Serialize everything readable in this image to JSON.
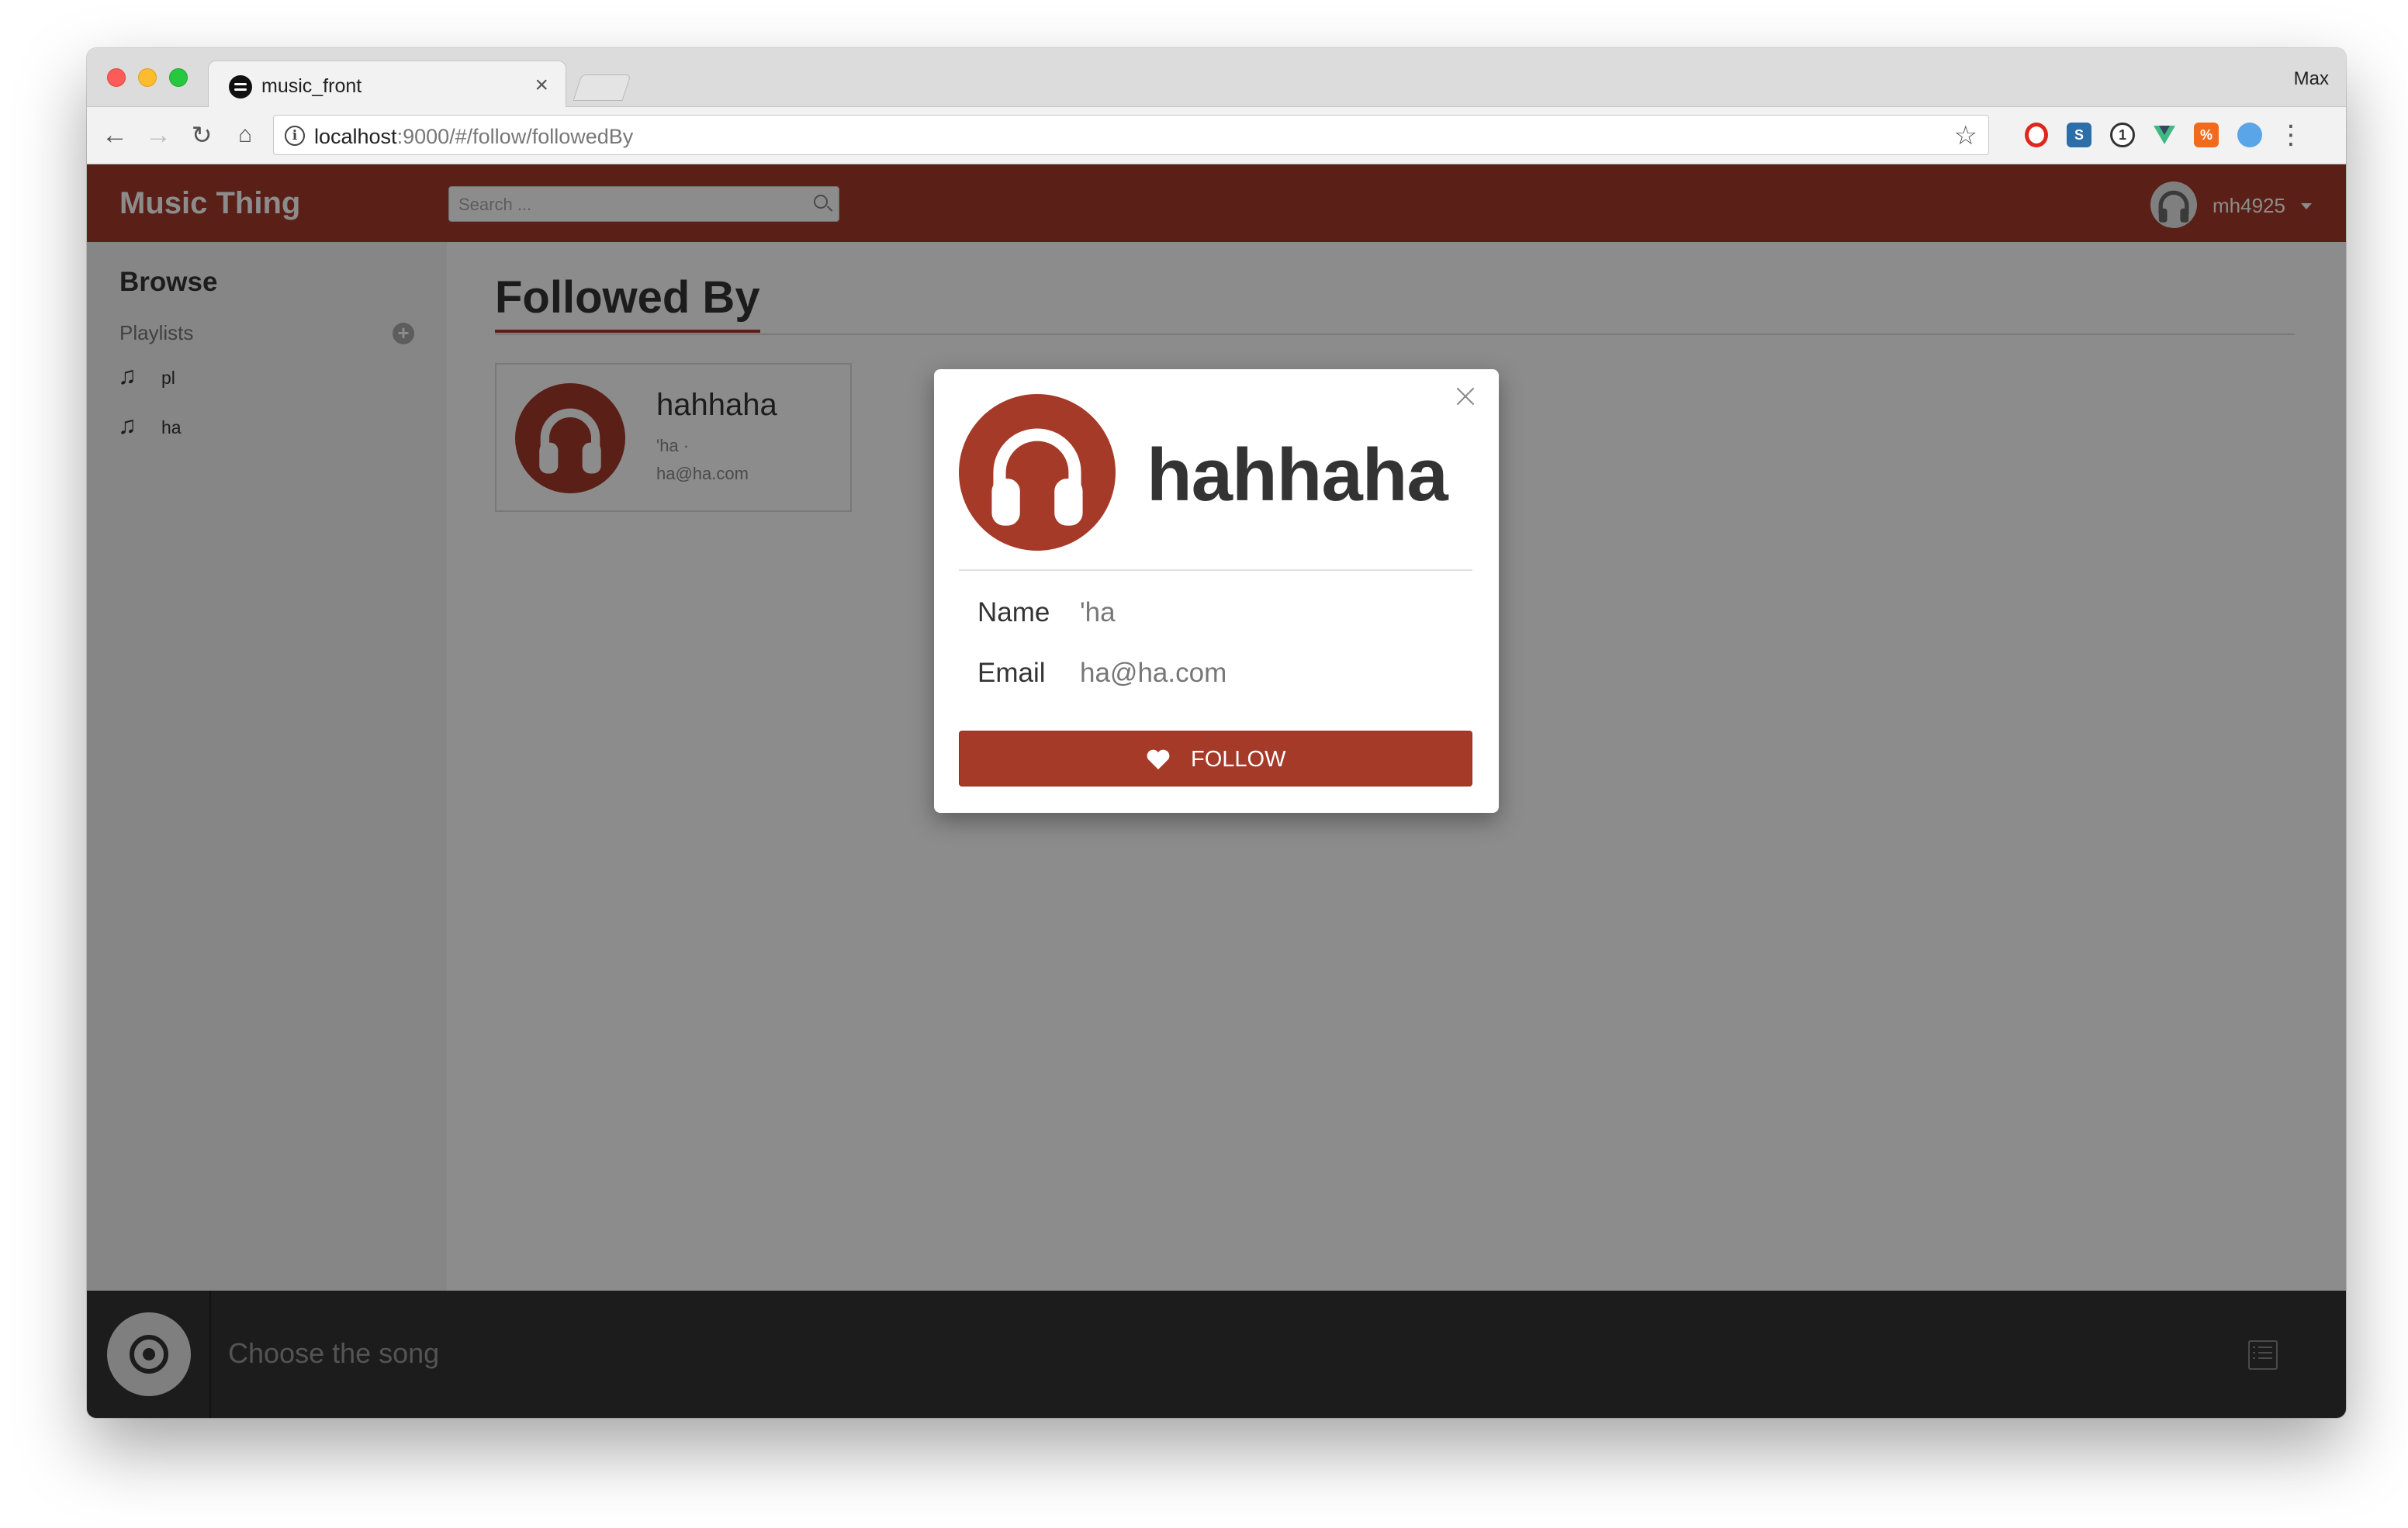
{
  "browser": {
    "tab_title": "music_front",
    "tab_close": "×",
    "profile_name": "Max",
    "url_host": "localhost",
    "url_rest": ":9000/#/follow/followedBy",
    "back": "←",
    "forward": "→",
    "reload": "↻",
    "home": "⌂",
    "info": "i",
    "star": "☆",
    "menu": "⋮",
    "extensions": {
      "s": "S",
      "onepass": "1",
      "pct": "%"
    }
  },
  "app": {
    "brand": "Music Thing",
    "search": {
      "placeholder": "Search ..."
    },
    "user": {
      "name": "mh4925"
    }
  },
  "sidebar": {
    "title": "Browse",
    "section": "Playlists",
    "add": "+",
    "items": [
      {
        "icon": "♫",
        "label": "pl"
      },
      {
        "icon": "♫",
        "label": "ha"
      }
    ]
  },
  "main": {
    "title": "Followed By",
    "card": {
      "name": "hahhaha",
      "subtitle": "'ha ·",
      "email": "ha@ha.com"
    }
  },
  "player": {
    "text": "Choose the song"
  },
  "modal": {
    "name": "hahhaha",
    "name_label": "Name",
    "name_value": "'ha",
    "email_label": "Email",
    "email_value": "ha@ha.com",
    "follow_label": "FOLLOW"
  },
  "colors": {
    "brand": "#a53a29",
    "player_bg": "#333333"
  },
  "icons": {
    "avatar": "headphones-icon",
    "follow": "heart-icon",
    "playlist": "list-icon",
    "player": "disc-icon"
  }
}
